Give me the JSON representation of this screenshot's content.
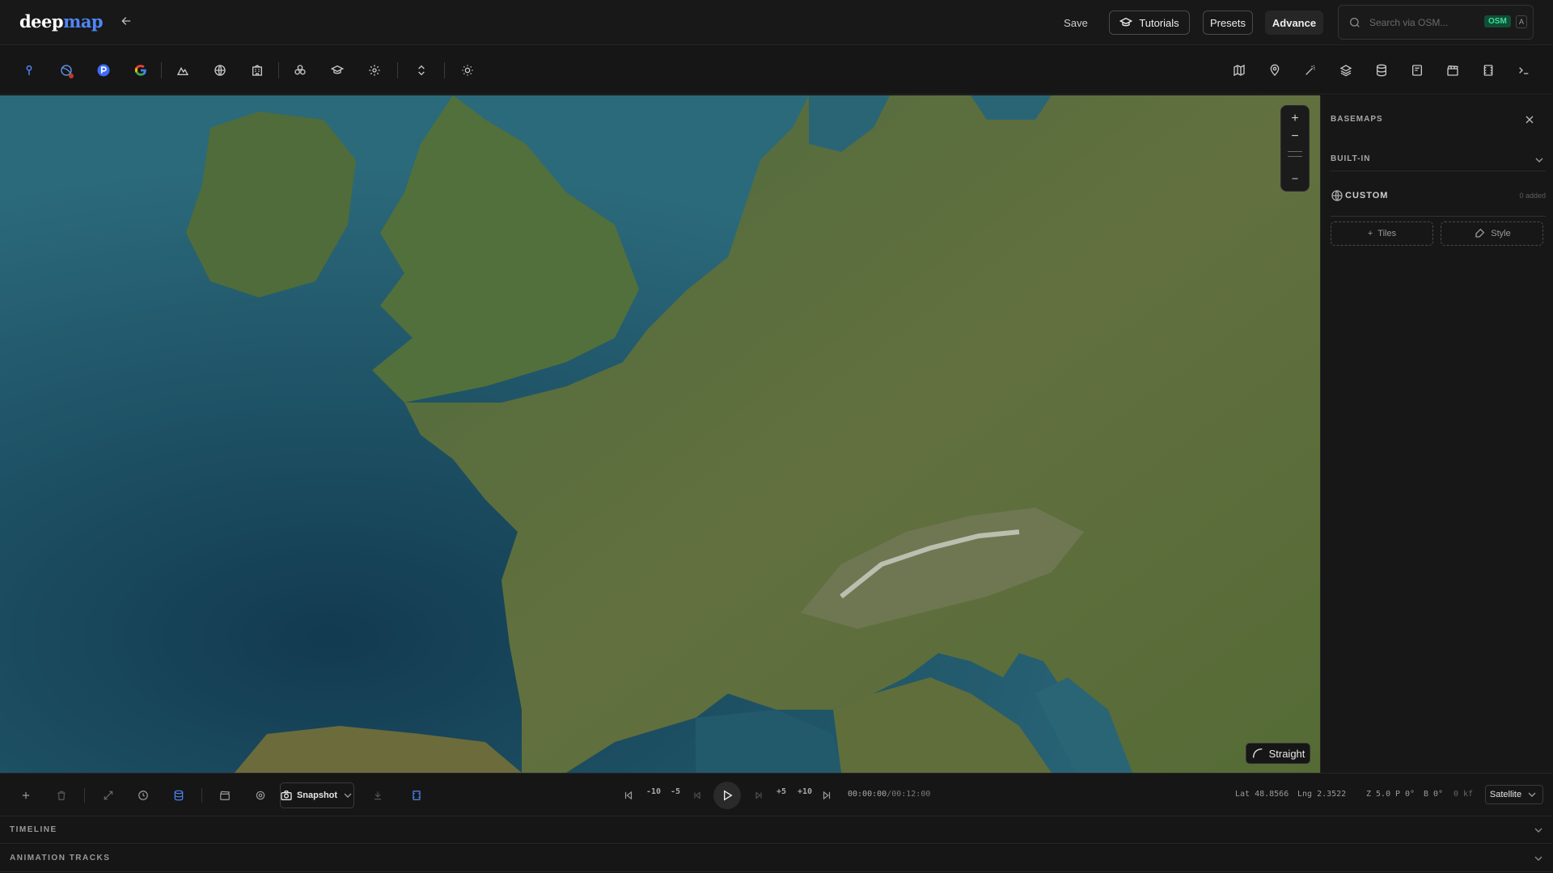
{
  "app": {
    "logo_part1": "deep",
    "logo_part2": "map"
  },
  "header": {
    "save_label": "Save",
    "tutorials_label": "Tutorials",
    "presets_label": "Presets",
    "advance_label": "Advance",
    "search": {
      "placeholder": "Search via OSM...",
      "value": "",
      "source_badge": "OSM",
      "shortcut_key": "A"
    }
  },
  "toolbar_left_icons": [
    "marker-icon",
    "globe-orbit-icon",
    "route-provider-icon",
    "google-icon",
    "terrain-icon",
    "globe-icon",
    "building-icon",
    "layers-cluster-icon",
    "graduation-cap-icon",
    "settings-icon",
    "expand-vertical-icon",
    "sun-icon"
  ],
  "toolbar_right_icons": [
    "map-icon",
    "pin-icon",
    "magic-wand-icon",
    "layers-icon",
    "database-icon",
    "route-panel-icon",
    "clapperboard-icon",
    "film-icon",
    "terminal-icon"
  ],
  "map": {
    "zoom_in": "+",
    "zoom_out": "−",
    "route_mode_label": "Straight"
  },
  "side_panel": {
    "title": "BASEMAPS",
    "builtin_label": "BUILT-IN",
    "custom_label": "CUSTOM",
    "custom_count": "0 added",
    "tiles_button": "Tiles",
    "style_button": "Style"
  },
  "bottom_bar": {
    "snapshot_label": "Snapshot",
    "step_back_10": "-10",
    "step_back_5": "-5",
    "step_fwd_5": "+5",
    "step_fwd_10": "+10",
    "time_current": "00:00:00",
    "time_separator": "/",
    "time_total": "00:12:00",
    "lat": "Lat 48.8566",
    "lng": "Lng 2.3522",
    "zoom": "Z 5.0",
    "pitch": "P 0°",
    "bearing": "B 0°",
    "keyframes": "0 kf",
    "basemap_value": "Satellite"
  },
  "sections": {
    "timeline": "TIMELINE",
    "animation_tracks": "ANIMATION TRACKS"
  },
  "colors": {
    "accent_blue": "#4f86f7",
    "osm_green": "#3fdc97",
    "sea": "#2a6576",
    "land": "#4f6a3a"
  }
}
